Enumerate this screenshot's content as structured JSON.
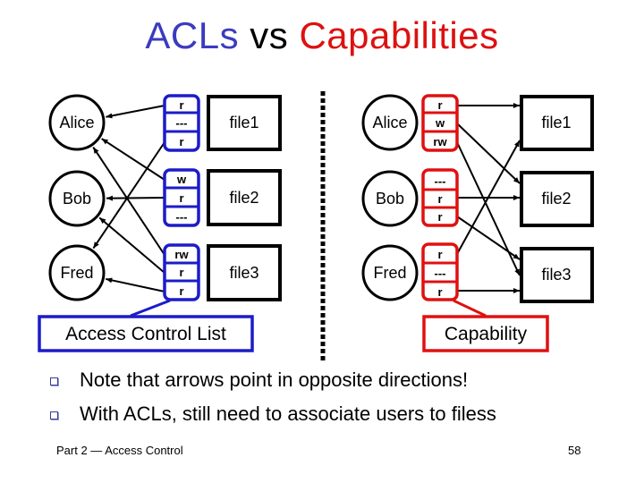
{
  "title": {
    "part1": "ACLs",
    "part2": "vs",
    "part3": "Capabilities"
  },
  "colors": {
    "acl_blue": "#1c1cc8",
    "capability_red": "#e01010",
    "title_blue": "#3b3bbf",
    "title_red": "#dd1111"
  },
  "acl_side": {
    "users": [
      "Alice",
      "Bob",
      "Fred"
    ],
    "files": [
      {
        "name": "file1",
        "acl": [
          "r",
          "---",
          "r"
        ]
      },
      {
        "name": "file2",
        "acl": [
          "w",
          "r",
          "---"
        ]
      },
      {
        "name": "file3",
        "acl": [
          "rw",
          "r",
          "r"
        ]
      }
    ],
    "label": "Access Control List"
  },
  "capability_side": {
    "users": [
      {
        "name": "Alice",
        "caps": [
          "r",
          "w",
          "rw"
        ]
      },
      {
        "name": "Bob",
        "caps": [
          "---",
          "r",
          "r"
        ]
      },
      {
        "name": "Fred",
        "caps": [
          "r",
          "---",
          "r"
        ]
      }
    ],
    "files": [
      "file1",
      "file2",
      "file3"
    ],
    "label": "Capability"
  },
  "bullets": [
    "Note that arrows point in opposite directions!",
    "With ACLs, still need to associate users to filess"
  ],
  "footer": {
    "left": "Part 2 — Access Control",
    "page": "58"
  }
}
